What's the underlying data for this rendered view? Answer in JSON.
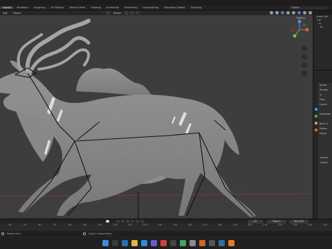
{
  "workspace_tabs": [
    {
      "label": "Layout",
      "active": true
    },
    {
      "label": "Modeling",
      "active": false
    },
    {
      "label": "Sculpting",
      "active": false
    },
    {
      "label": "UV Editing",
      "active": false
    },
    {
      "label": "Texture Paint",
      "active": false
    },
    {
      "label": "Shading",
      "active": false
    },
    {
      "label": "Animation",
      "active": false
    },
    {
      "label": "Rendering",
      "active": false
    },
    {
      "label": "Compositing",
      "active": false
    },
    {
      "label": "Geometry Nodes",
      "active": false
    },
    {
      "label": "Scripting",
      "active": false
    }
  ],
  "scene": {
    "label": "Scene"
  },
  "header": {
    "edit_label": "Edit",
    "object_label": "Object",
    "transform_orientation": "Global",
    "options_label": "Options"
  },
  "outliner": {
    "rows": [
      "Scene Coll",
      "Col",
      "Ar",
      "Ku"
    ]
  },
  "properties": {
    "rows": [
      "Armat",
      "Armatu",
      "ar",
      "Pose",
      "Layers",
      "",
      "Protected",
      "",
      "Bone G",
      "Motion",
      "Viewp",
      "",
      "",
      "",
      "",
      "Inverse",
      "Custom"
    ]
  },
  "timeline": {
    "ticks": [
      "40",
      "50",
      "60",
      "70",
      "80",
      "90",
      "100",
      "110",
      "120",
      "130",
      "140",
      "150",
      "160",
      "170",
      "180",
      "190",
      "200",
      "210",
      "220",
      "230",
      "240",
      "250"
    ],
    "current_frame": "23",
    "start_label": "Start",
    "start_value": "1",
    "end_label": "End",
    "end_value": "250"
  },
  "status": {
    "left": "Rotate View",
    "middle": "Object Context Menu"
  },
  "taskbar": {
    "time": "",
    "date": ""
  }
}
